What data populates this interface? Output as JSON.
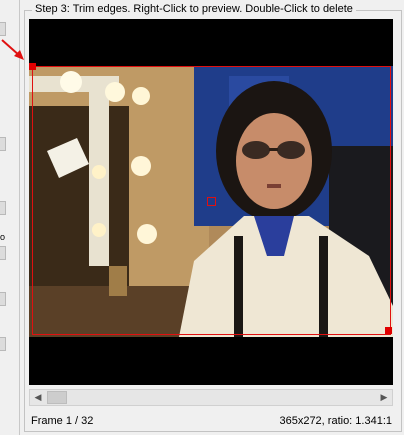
{
  "group": {
    "title": "Step 3: Trim edges. Right-Click to preview. Double-Click to delete"
  },
  "left_panel": {
    "fragment_text": "o"
  },
  "status": {
    "frame_label": "Frame  1 / 32",
    "dimensions": "365x272, ratio: 1.341:1"
  },
  "crop": {
    "color": "#e01010"
  },
  "icons": {
    "scroll_left": "left-arrow-icon",
    "scroll_right": "right-arrow-icon",
    "pointer": "red-arrow-icon"
  },
  "scroll": {
    "position": 0.0
  }
}
